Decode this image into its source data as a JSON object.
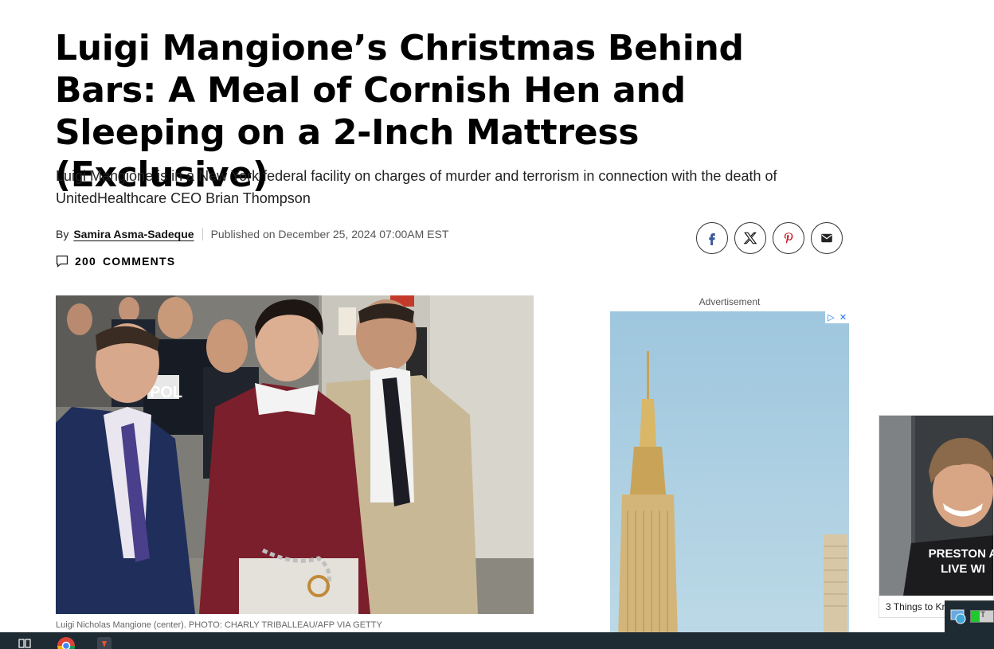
{
  "article": {
    "headline": "Luigi Mangione’s Christmas Behind Bars: A Meal of Cornish Hen and Sleeping on a 2-Inch Mattress (Exclusive)",
    "dek": "Luigi Mangione is in a New York federal facility on charges of murder and terrorism in connection with the death of UnitedHealthcare CEO Brian Thompson",
    "byline": {
      "by": "By",
      "author": "Samira Asma-Sadeque",
      "published": "Published on December 25, 2024 07:00AM EST"
    },
    "comments": {
      "count": "200",
      "label": "COMMENTS"
    },
    "photo": {
      "caption": "Luigi Nicholas Mangione (center). PHOTO: CHARLY TRIBALLEAU/AFP VIA GETTY",
      "badge_text": "POL"
    }
  },
  "share": {
    "icons": [
      "facebook-icon",
      "x-icon",
      "pinterest-icon",
      "email-icon"
    ]
  },
  "ad": {
    "label": "Advertisement"
  },
  "video": {
    "overlay_line1": "PRESTON A",
    "overlay_line2": "LIVE WI",
    "caption": "3 Things to Kr"
  },
  "system_tray": {
    "progress_label": "T",
    "progress_fraction": 0.4
  },
  "colors": {
    "facebook": "#3b5998",
    "pinterest": "#c8232c",
    "taskbar": "#1f2b33",
    "sweater": "#7a1f2b",
    "suit_navy": "#1f2e5a"
  }
}
